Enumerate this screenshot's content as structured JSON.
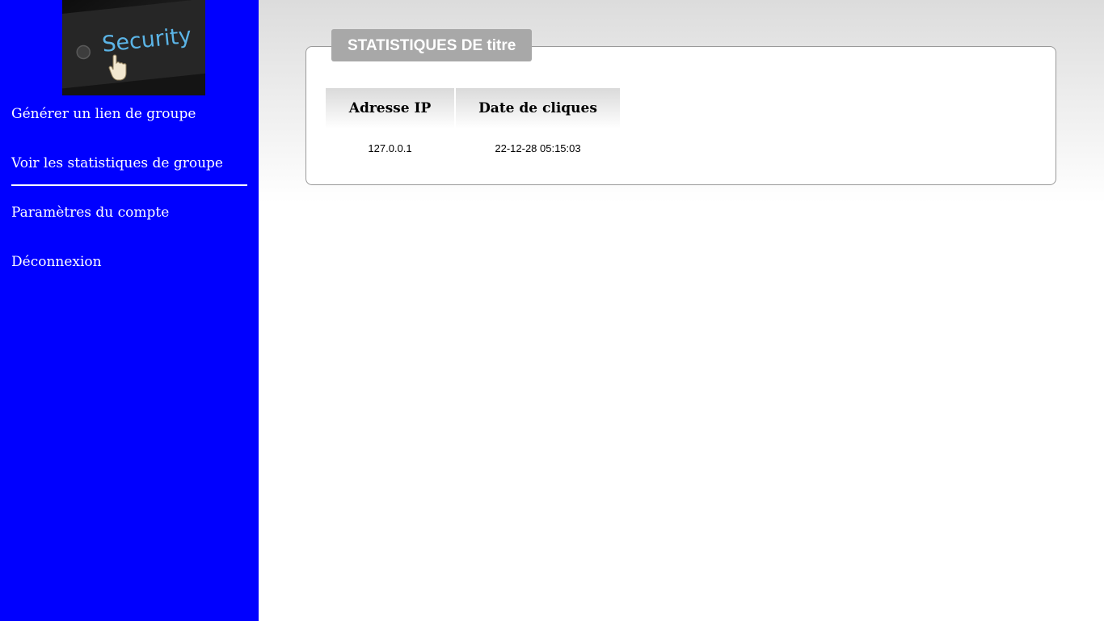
{
  "sidebar": {
    "logo": {
      "text": "Security",
      "icon": "hand-cursor-icon"
    },
    "items": [
      {
        "label": "Générer un lien de groupe"
      },
      {
        "label": "Voir les statistiques de groupe",
        "active": true
      },
      {
        "label": "Paramètres du compte"
      },
      {
        "label": "Déconnexion"
      }
    ]
  },
  "panel": {
    "title": "STATISTIQUES DE titre",
    "table": {
      "headers": [
        "Adresse IP",
        "Date de cliques"
      ],
      "rows": [
        [
          "127.0.0.1",
          "22-12-28 05:15:03"
        ]
      ]
    }
  },
  "colors": {
    "sidebar_bg": "#0000ff",
    "panel_title_bg": "#a8a8a8"
  }
}
